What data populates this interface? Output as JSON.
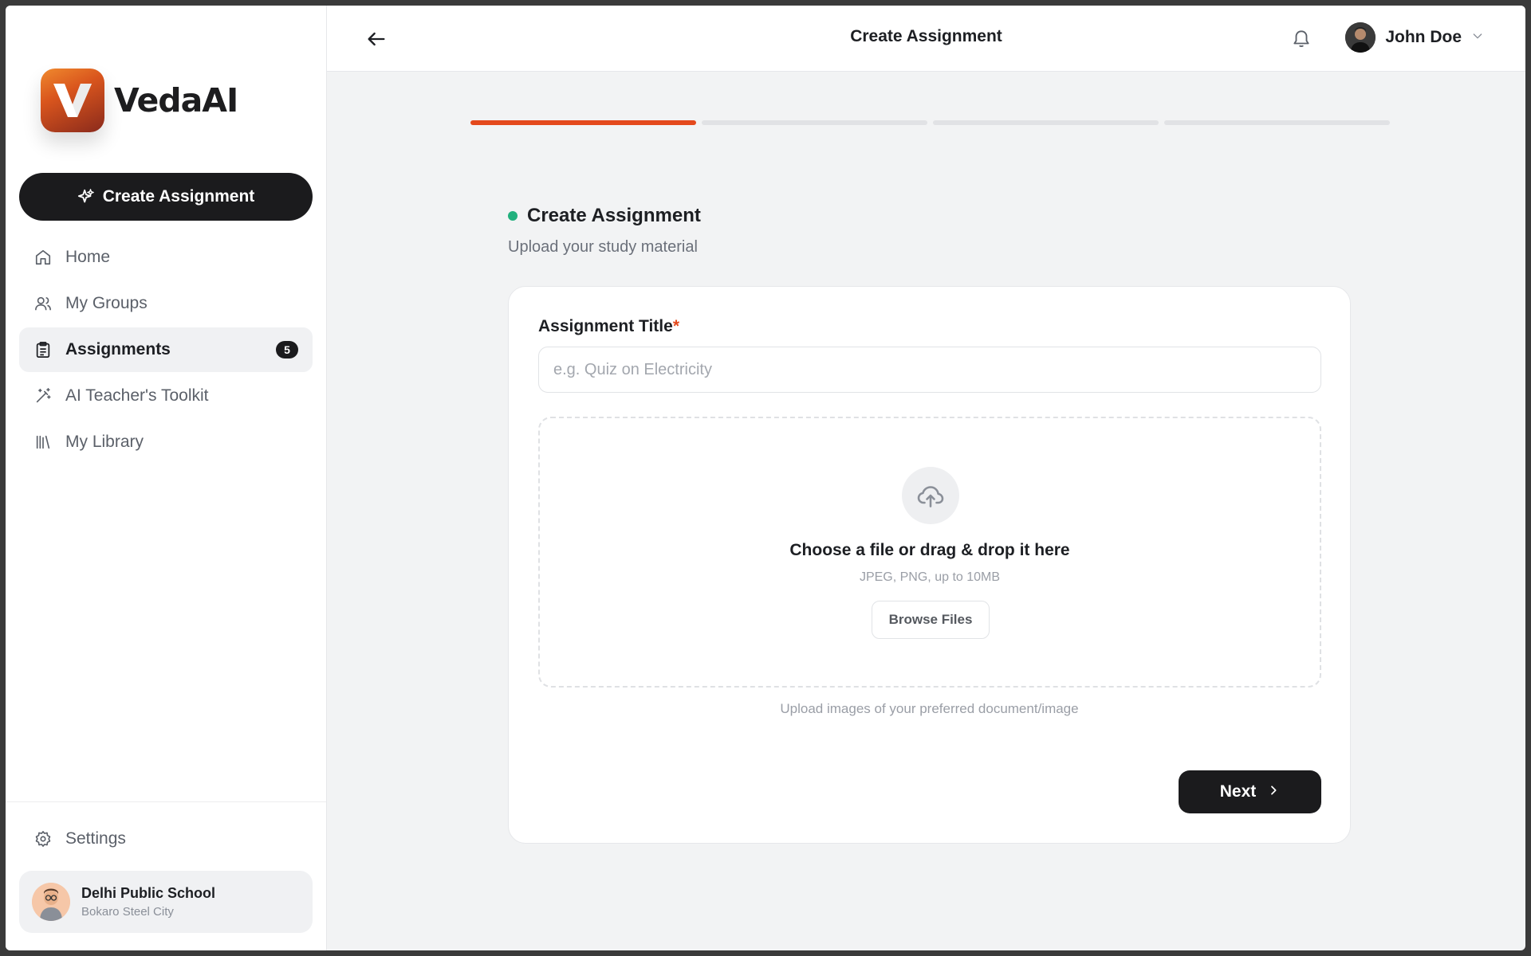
{
  "brand": {
    "name": "VedaAI",
    "logo_icon": "veda-logo-icon"
  },
  "sidebar": {
    "create_button": {
      "label": "Create Assignment",
      "icon": "sparkles-icon"
    },
    "items": [
      {
        "label": "Home",
        "icon": "home-icon",
        "active": false
      },
      {
        "label": "My Groups",
        "icon": "users-icon",
        "active": false
      },
      {
        "label": "Assignments",
        "icon": "clipboard-icon",
        "active": true,
        "badge": "5"
      },
      {
        "label": "AI Teacher's Toolkit",
        "icon": "magic-wand-icon",
        "active": false
      },
      {
        "label": "My Library",
        "icon": "library-icon",
        "active": false
      }
    ],
    "settings": {
      "label": "Settings",
      "icon": "gear-icon"
    },
    "school": {
      "name": "Delhi Public School",
      "city": "Bokaro Steel City"
    }
  },
  "header": {
    "title": "Create Assignment",
    "user_name": "John Doe"
  },
  "progress": {
    "current_step": 1,
    "total_steps": 4
  },
  "section": {
    "title": "Create Assignment",
    "subtitle": "Upload your study material"
  },
  "form": {
    "title_label": "Assignment Title",
    "required_mark": "*",
    "title_placeholder": "e.g. Quiz on Electricity",
    "title_value": "",
    "dropzone": {
      "title": "Choose a file or drag & drop it here",
      "hint": "JPEG, PNG, up to 10MB",
      "browse_label": "Browse Files",
      "footer": "Upload images of your preferred document/image"
    },
    "next_label": "Next"
  },
  "colors": {
    "accent": "#e4491c",
    "primary_dark": "#1b1b1d",
    "status_dot": "#22b07d",
    "background": "#f2f3f4"
  }
}
